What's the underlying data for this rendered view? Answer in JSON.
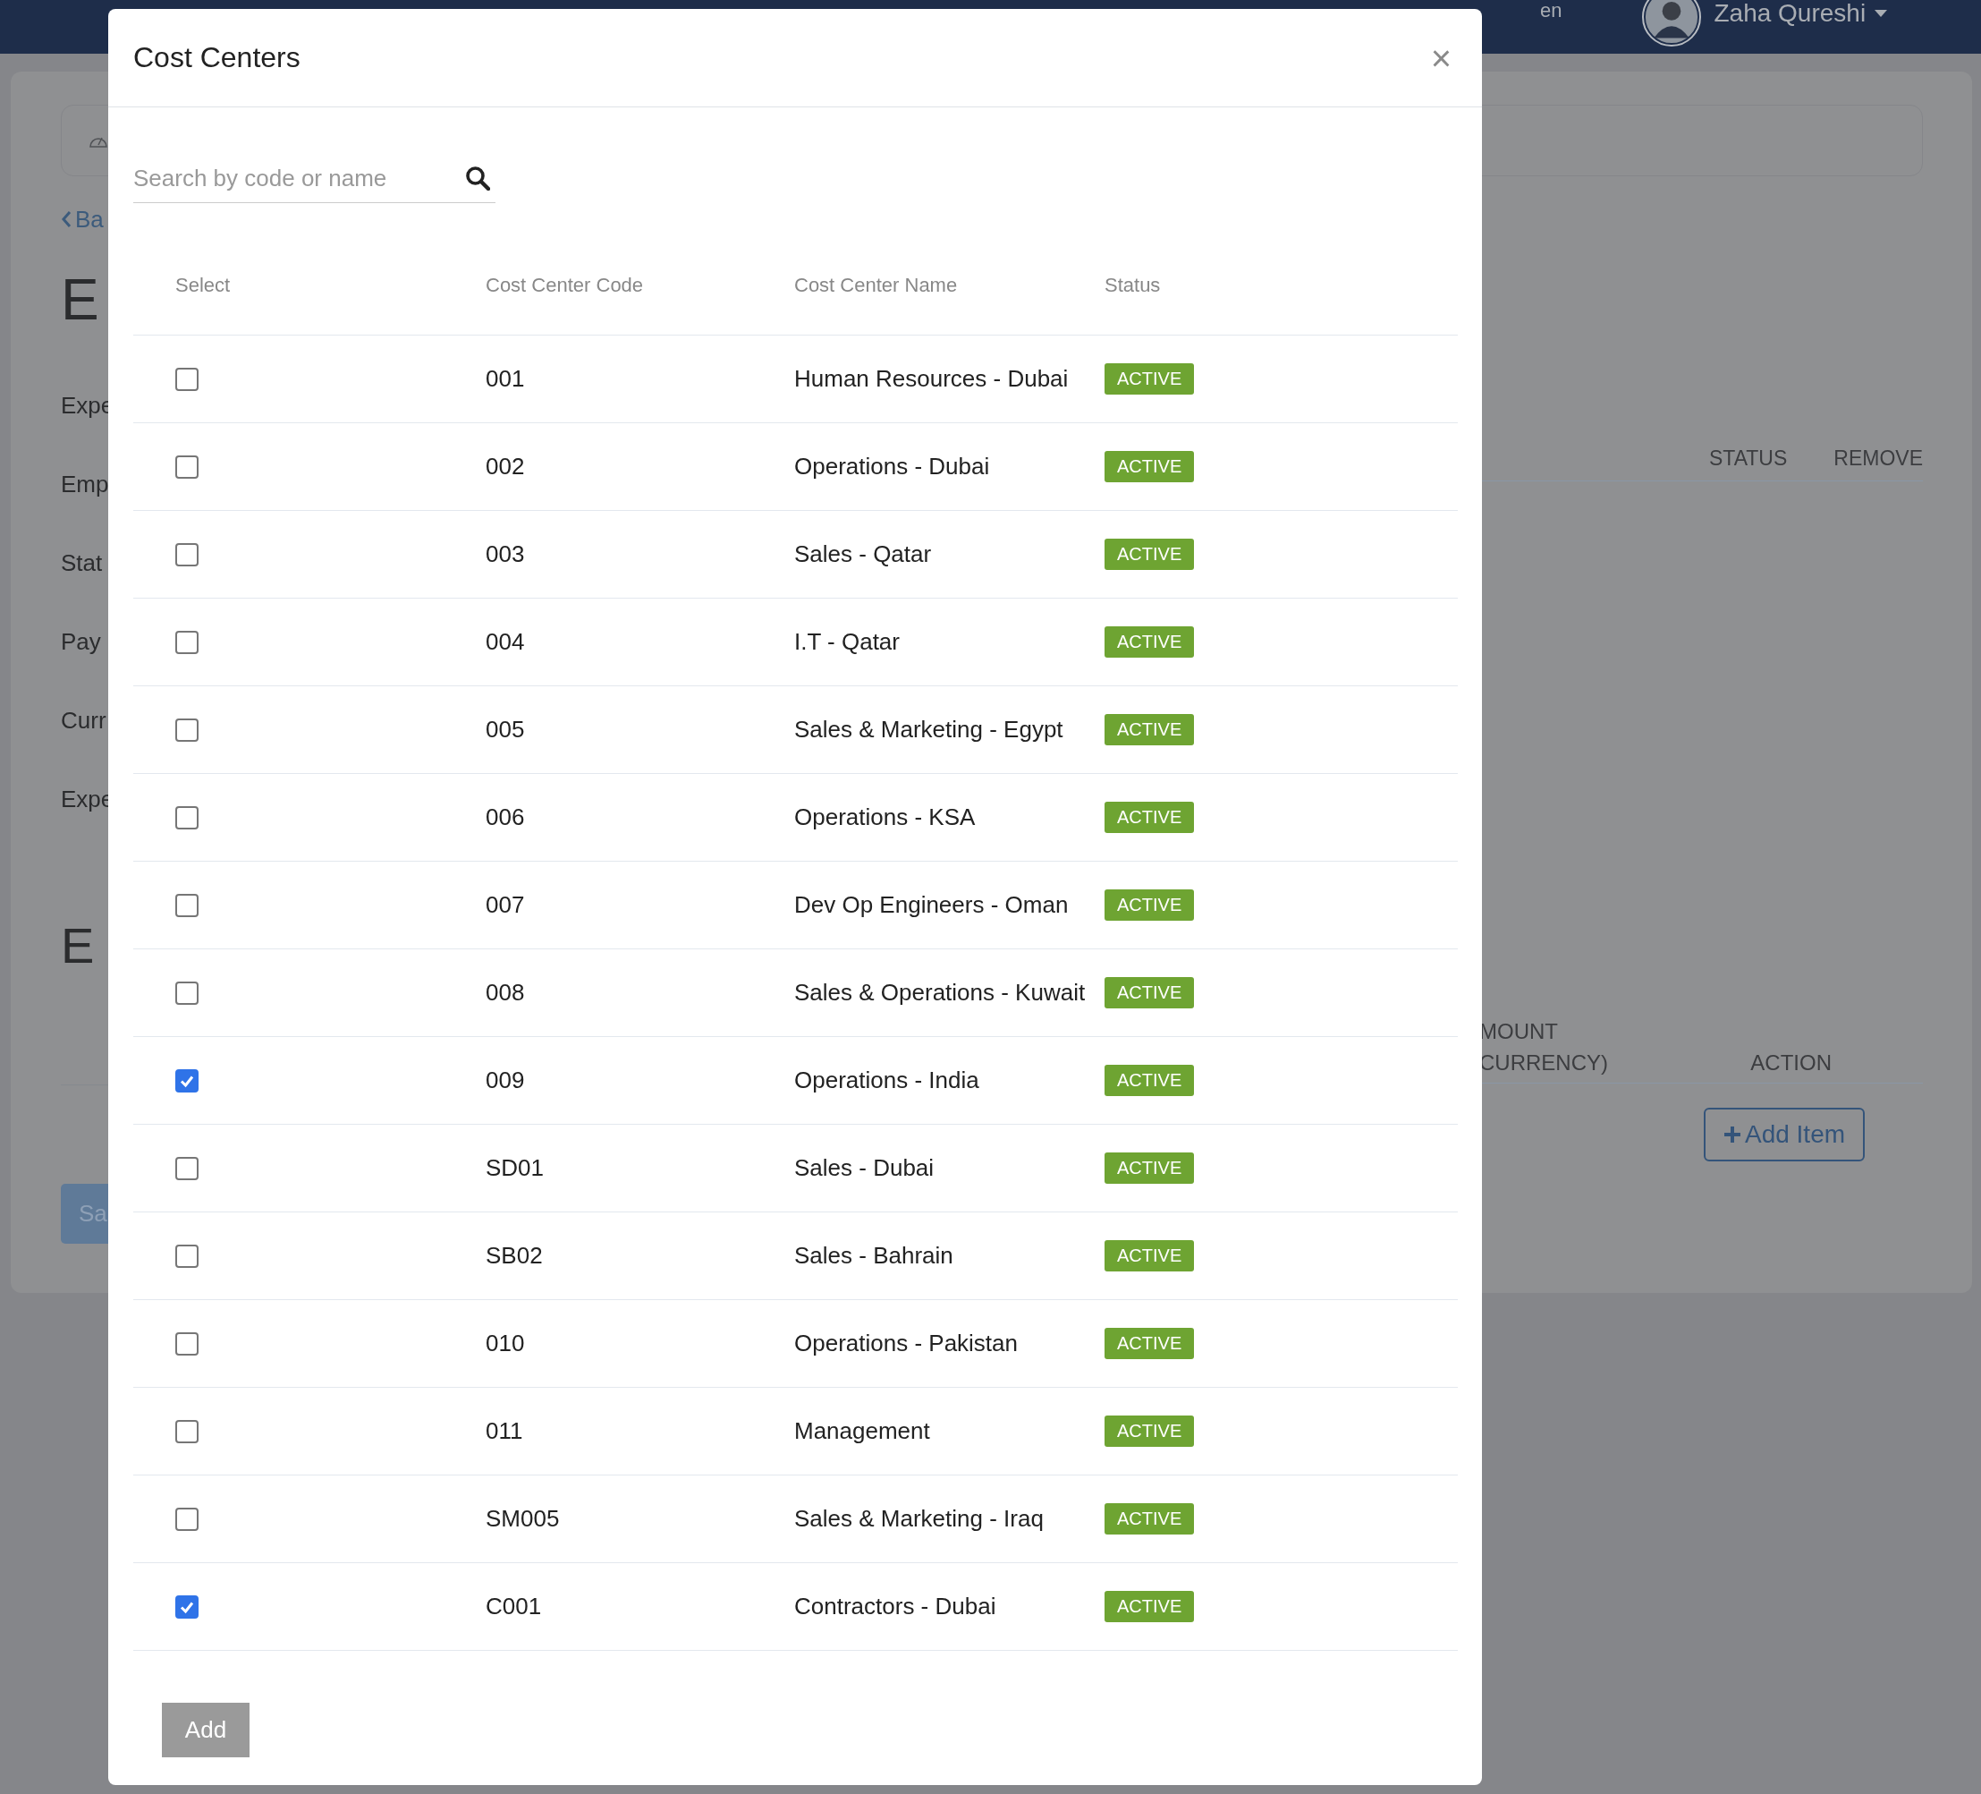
{
  "navbar": {
    "language": "en",
    "user_name": "Zaha Qureshi"
  },
  "page": {
    "back_link": "Ba",
    "title": "E",
    "fields": [
      "Expe",
      "Emp",
      "Stat",
      "Pay",
      "Curr",
      "Expe"
    ],
    "section_title": "E",
    "save_button": "Sa",
    "table_1_columns": [
      "STATUS",
      "REMOVE"
    ],
    "table_2_columns": [
      "MOUNT\nCURRENCY)",
      "ACTION"
    ],
    "add_item_button": "Add Item"
  },
  "modal": {
    "title": "Cost Centers",
    "close": "×",
    "search": {
      "placeholder": "Search by code or name"
    },
    "columns": [
      "Select",
      "Cost Center Code",
      "Cost Center Name",
      "Status"
    ],
    "rows": [
      {
        "checked": false,
        "code": "001",
        "name": "Human Resources - Dubai",
        "status": "ACTIVE"
      },
      {
        "checked": false,
        "code": "002",
        "name": "Operations - Dubai",
        "status": "ACTIVE"
      },
      {
        "checked": false,
        "code": "003",
        "name": "Sales - Qatar",
        "status": "ACTIVE"
      },
      {
        "checked": false,
        "code": "004",
        "name": "I.T - Qatar",
        "status": "ACTIVE"
      },
      {
        "checked": false,
        "code": "005",
        "name": "Sales & Marketing - Egypt",
        "status": "ACTIVE"
      },
      {
        "checked": false,
        "code": "006",
        "name": "Operations - KSA",
        "status": "ACTIVE"
      },
      {
        "checked": false,
        "code": "007",
        "name": "Dev Op Engineers - Oman",
        "status": "ACTIVE"
      },
      {
        "checked": false,
        "code": "008",
        "name": "Sales & Operations - Kuwait",
        "status": "ACTIVE"
      },
      {
        "checked": true,
        "code": "009",
        "name": "Operations - India",
        "status": "ACTIVE"
      },
      {
        "checked": false,
        "code": "SD01",
        "name": "Sales - Dubai",
        "status": "ACTIVE"
      },
      {
        "checked": false,
        "code": "SB02",
        "name": "Sales - Bahrain",
        "status": "ACTIVE"
      },
      {
        "checked": false,
        "code": "010",
        "name": "Operations - Pakistan",
        "status": "ACTIVE"
      },
      {
        "checked": false,
        "code": "011",
        "name": "Management",
        "status": "ACTIVE"
      },
      {
        "checked": false,
        "code": "SM005",
        "name": "Sales & Marketing - Iraq",
        "status": "ACTIVE"
      },
      {
        "checked": true,
        "code": "C001",
        "name": "Contractors - Dubai",
        "status": "ACTIVE"
      }
    ],
    "add_button": "Add"
  }
}
